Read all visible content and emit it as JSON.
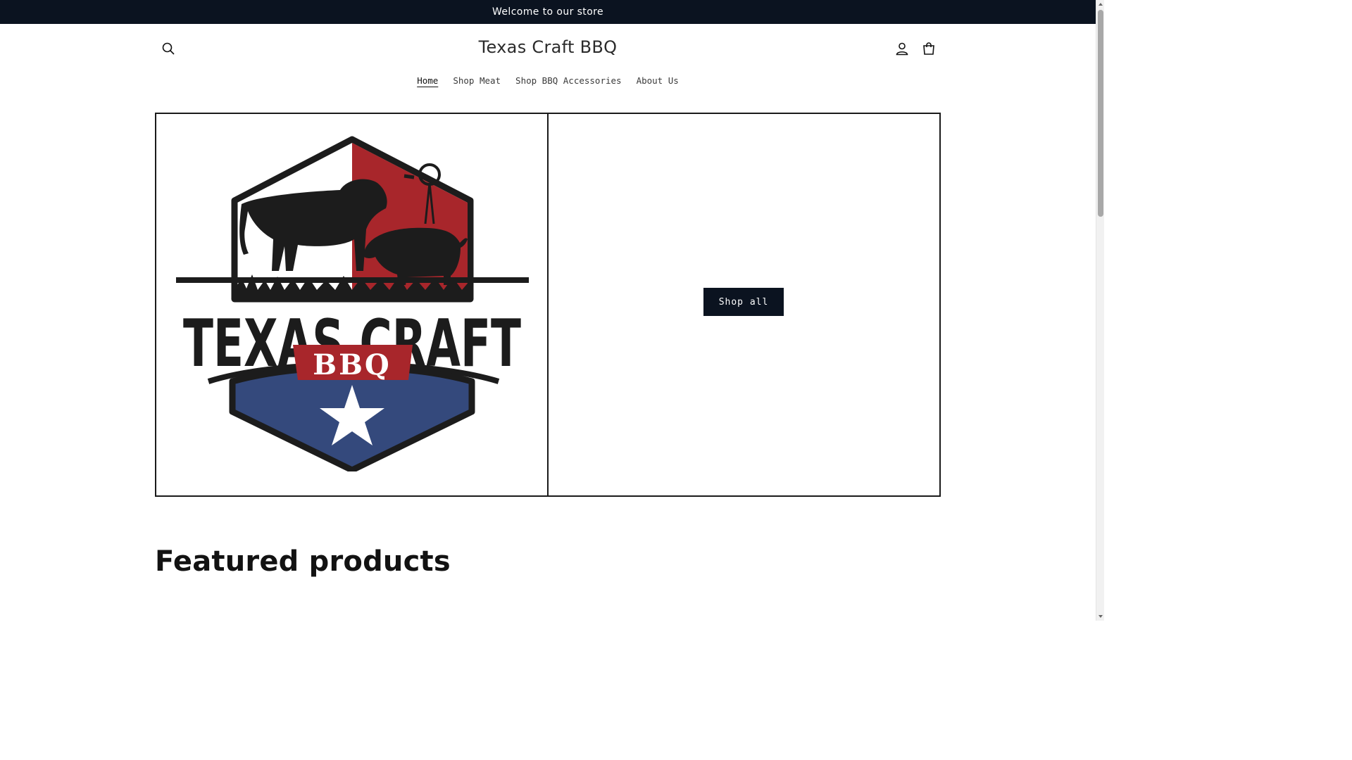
{
  "announcement": {
    "text": "Welcome to our store"
  },
  "header": {
    "title": "Texas Craft BBQ",
    "icons": {
      "search": "search-icon",
      "account": "account-icon",
      "cart": "cart-icon"
    }
  },
  "nav": {
    "items": [
      {
        "label": "Home",
        "active": true
      },
      {
        "label": "Shop Meat",
        "active": false
      },
      {
        "label": "Shop BBQ Accessories",
        "active": false
      },
      {
        "label": "About Us",
        "active": false
      }
    ]
  },
  "hero": {
    "logo": {
      "line1": "TEXAS CRAFT",
      "line2": "BBQ"
    },
    "button_label": "Shop all"
  },
  "featured": {
    "heading": "Featured products"
  },
  "colors": {
    "announcement_bg": "#0b1320",
    "button_bg": "#0b1320",
    "logo_red": "#a8262b",
    "logo_blue": "#34497c",
    "logo_black": "#1c1c1c"
  }
}
